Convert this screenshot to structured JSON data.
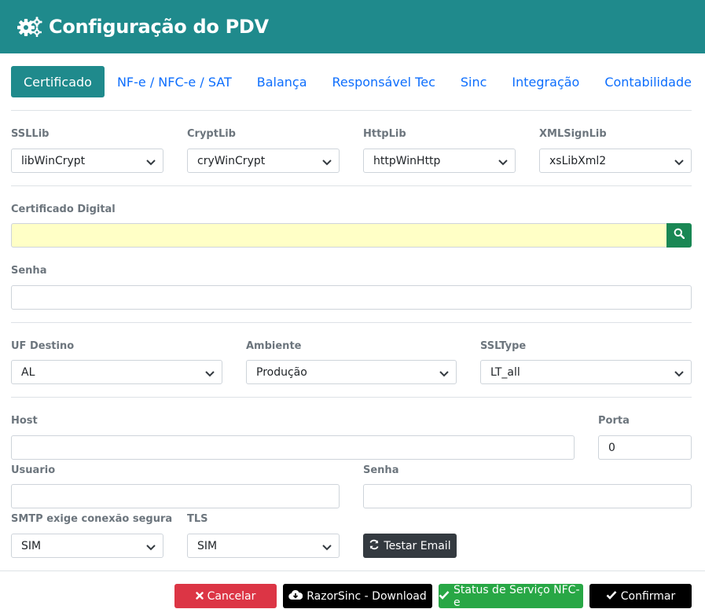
{
  "header": {
    "title": "Configuração do PDV",
    "icon": "gears-icon"
  },
  "tabs": [
    {
      "label": "Certificado",
      "active": true
    },
    {
      "label": "NF-e / NFC-e / SAT"
    },
    {
      "label": "Balança"
    },
    {
      "label": "Responsável Tec"
    },
    {
      "label": "Sinc"
    },
    {
      "label": "Integração"
    },
    {
      "label": "Contabilidade"
    }
  ],
  "libs": {
    "ssllib": {
      "label": "SSLLib",
      "value": "libWinCrypt"
    },
    "cryptlib": {
      "label": "CryptLib",
      "value": "cryWinCrypt"
    },
    "httplib": {
      "label": "HttpLib",
      "value": "httpWinHttp"
    },
    "xmlsignlib": {
      "label": "XMLSignLib",
      "value": "xsLibXml2"
    }
  },
  "certificado": {
    "label": "Certificado Digital",
    "value": ""
  },
  "senha_cert": {
    "label": "Senha",
    "value": ""
  },
  "envio": {
    "uf": {
      "label": "UF Destino",
      "value": "AL"
    },
    "ambiente": {
      "label": "Ambiente",
      "value": "Produção"
    },
    "ssltype": {
      "label": "SSLType",
      "value": "LT_all"
    }
  },
  "email": {
    "host": {
      "label": "Host",
      "value": ""
    },
    "porta": {
      "label": "Porta",
      "value": "0"
    },
    "usuario": {
      "label": "Usuario",
      "value": ""
    },
    "senha": {
      "label": "Senha",
      "value": ""
    },
    "smtp_seguro": {
      "label": "SMTP exige conexão segura",
      "value": "SIM"
    },
    "tls": {
      "label": "TLS",
      "value": "SIM"
    },
    "testar_label": "Testar Email"
  },
  "footer": {
    "cancelar": "Cancelar",
    "razorsinc": "RazorSinc - Download",
    "status": "Status de Serviço NFC-e",
    "confirmar": "Confirmar"
  },
  "colors": {
    "header": "#1f8a8c",
    "link": "#0d6efd",
    "cert_bg": "#ffffc6",
    "search": "#198754",
    "cancel": "#dc3545",
    "status": "#28a745"
  }
}
